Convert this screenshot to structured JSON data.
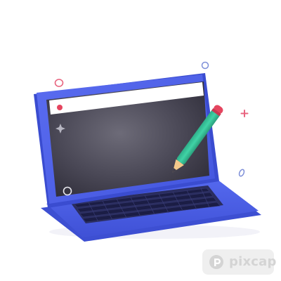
{
  "watermark": {
    "text": "pixcap",
    "icon": "pixcap-logo-icon"
  },
  "illustration": {
    "subject": "laptop-with-pencil",
    "colors": {
      "body": "#4f63ea",
      "body_shadow": "#3e4fcf",
      "screen": "#3f3d4a",
      "screen_glow": "#6b6976",
      "address_bar": "#ffffff",
      "record_dot": "#e5455f",
      "keyboard": "#2b2d5b",
      "key": "#1e2048",
      "pencil": "#35c49a",
      "pencil_eraser": "#e5455f",
      "pencil_wood": "#f3c98b",
      "sparkle_pink": "#e8647f",
      "sparkle_blue": "#7e8fd8"
    }
  }
}
